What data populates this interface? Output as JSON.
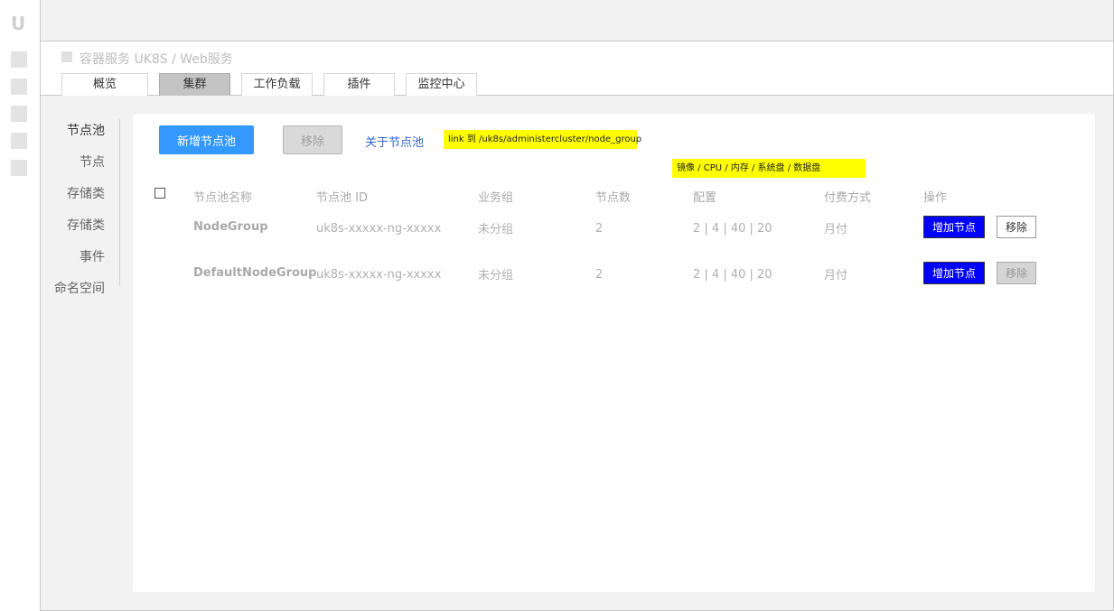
{
  "app": {
    "logo": "U",
    "breadcrumb": "容器服务 UK8S / Web服务"
  },
  "tabs": [
    {
      "label": "概览",
      "active": false
    },
    {
      "label": "集群",
      "active": true
    },
    {
      "label": "工作负载",
      "active": false
    },
    {
      "label": "插件",
      "active": false
    },
    {
      "label": "监控中心",
      "active": false
    }
  ],
  "subnav": [
    {
      "label": "节点池",
      "active": true
    },
    {
      "label": "节点",
      "active": false
    },
    {
      "label": "存储类",
      "active": false
    },
    {
      "label": "存储类",
      "active": false
    },
    {
      "label": "事件",
      "active": false
    },
    {
      "label": "命名空间",
      "active": false
    }
  ],
  "toolbar": {
    "create_label": "新增节点池",
    "remove_label": "移除",
    "about_label": "关于节点池"
  },
  "notes": {
    "link_note": "link 到 /uk8s/administercluster/node_group",
    "config_note": "镜像 / CPU / 内存 / 系统盘 / 数据盘"
  },
  "table": {
    "headers": [
      "节点池名称",
      "节点池 ID",
      "业务组",
      "节点数",
      "配置",
      "付费方式",
      "操作"
    ],
    "rows": [
      {
        "name": "NodeGroup",
        "id": "uk8s-xxxxx-ng-xxxxx",
        "group": "未分组",
        "nodes": "2",
        "config": "2 | 4 | 40 | 20",
        "billing": "月付",
        "add_label": "增加节点",
        "remove_label": "移除",
        "remove_disabled": false
      },
      {
        "name": "DefaultNodeGroup",
        "id": "uk8s-xxxxx-ng-xxxxx",
        "group": "未分组",
        "nodes": "2",
        "config": "2 | 4 | 40 | 20",
        "billing": "月付",
        "add_label": "增加节点",
        "remove_label": "移除",
        "remove_disabled": true
      }
    ]
  },
  "colors": {
    "primary": "#3399ff",
    "add_button": "#0000ff",
    "note_highlight": "#ffff00",
    "link": "#3366cc"
  }
}
